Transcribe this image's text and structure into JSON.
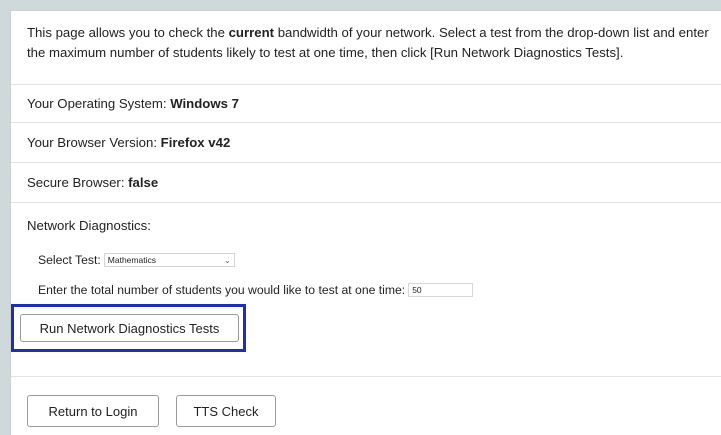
{
  "intro": {
    "text_before": "This page allows you to check the ",
    "text_bold": "current",
    "text_after": " bandwidth of your network. Select a test from the drop-down list and enter the maximum number of students likely to test at one time, then click [Run Network Diagnostics Tests]."
  },
  "os": {
    "label": "Your Operating System: ",
    "value": "Windows 7"
  },
  "browser": {
    "label": "Your Browser Version: ",
    "value": "Firefox v42"
  },
  "secure": {
    "label": "Secure Browser: ",
    "value": "false"
  },
  "diagnostics": {
    "heading": "Network Diagnostics:",
    "select_label": "Select Test:",
    "select_value": "Mathematics",
    "students_label": "Enter the total number of students you would like to test at one time:",
    "students_value": "50",
    "run_button": "Run Network Diagnostics Tests"
  },
  "footer": {
    "return_button": "Return to Login",
    "tts_button": "TTS Check"
  },
  "colors": {
    "highlight_border": "#1d2fb8",
    "page_background": "#cfd9dc"
  }
}
